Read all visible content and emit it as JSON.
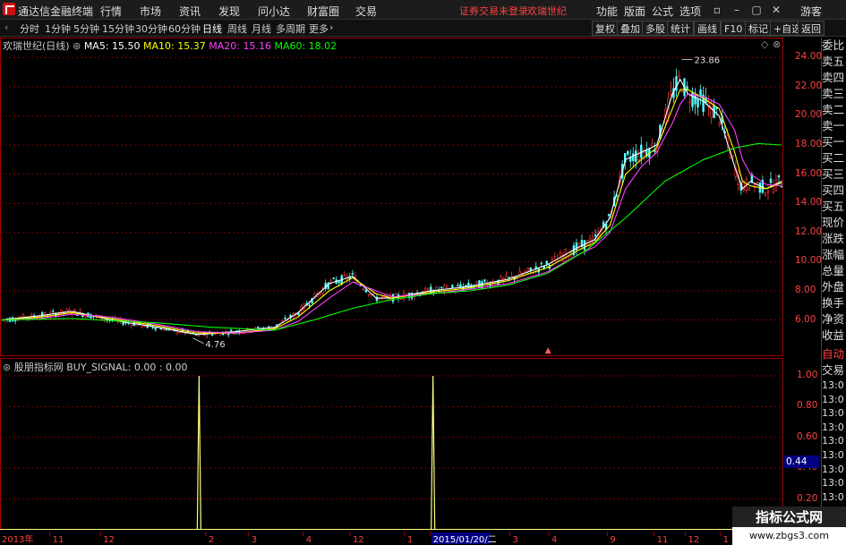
{
  "app": {
    "title": "通达信金融终端",
    "menu": [
      "行情",
      "市场",
      "资讯",
      "发现",
      "问小达",
      "财富圈",
      "交易"
    ],
    "warning": "证券交易未登录",
    "stock_name": "欢瑞世纪",
    "right_menu": [
      "功能",
      "版面",
      "公式",
      "选项"
    ],
    "guest": "游客"
  },
  "toolbar": {
    "periods": [
      "分时",
      "1分钟",
      "5分钟",
      "15分钟",
      "30分钟",
      "60分钟",
      "日线",
      "周线",
      "月线",
      "多周期",
      "更多"
    ],
    "active_period": "日线",
    "right_buttons": [
      "复权",
      "叠加",
      "多股",
      "统计",
      "画线",
      "F10",
      "标记",
      "+自选",
      "返回"
    ]
  },
  "main_legend": {
    "title": "欢瑞世纪(日线)",
    "ma5_label": "MA5: 15.50",
    "ma10_label": "MA10: 15.37",
    "ma20_label": "MA20: 15.16",
    "ma60_label": "MA60: 18.02",
    "colors": {
      "ma5": "#ffffff",
      "ma10": "#ffff00",
      "ma20": "#ff40ff",
      "ma60": "#00ff00"
    }
  },
  "sub_legend": {
    "title": "股朋指标网  BUY_SIGNAL: 0.00 : 0.00"
  },
  "chart_data": [
    {
      "type": "line",
      "title": "欢瑞世纪(日线)",
      "ylim": [
        4.5,
        25
      ],
      "yticks": [
        "24.00",
        "22.00",
        "20.00",
        "18.00",
        "16.00",
        "14.00",
        "12.00",
        "10.00",
        "8.00",
        "6.00"
      ],
      "annotations": [
        {
          "label": "23.86",
          "t": 0.872,
          "value": 23.86
        },
        {
          "label": "4.76",
          "t": 0.245,
          "value": 4.76
        }
      ],
      "series": [
        {
          "name": "MA5",
          "color": "#ffffff",
          "t": [
            0,
            0.05,
            0.09,
            0.14,
            0.2,
            0.25,
            0.3,
            0.35,
            0.38,
            0.42,
            0.45,
            0.48,
            0.5,
            0.55,
            0.6,
            0.65,
            0.7,
            0.74,
            0.76,
            0.78,
            0.8,
            0.82,
            0.84,
            0.86,
            0.87,
            0.88,
            0.9,
            0.92,
            0.94,
            0.95,
            0.96,
            0.98,
            1.0
          ],
          "values": [
            6.0,
            6.3,
            6.6,
            6.0,
            5.5,
            5.0,
            5.2,
            5.5,
            6.5,
            8.5,
            9.0,
            7.5,
            7.5,
            8.0,
            8.3,
            8.8,
            9.8,
            11.0,
            11.5,
            13.0,
            17.0,
            17.5,
            18.0,
            21.5,
            22.5,
            21.5,
            21.0,
            20.0,
            16.5,
            15.0,
            15.5,
            15.0,
            15.5
          ]
        },
        {
          "name": "MA10",
          "color": "#ffff00",
          "t": [
            0,
            0.05,
            0.09,
            0.14,
            0.2,
            0.25,
            0.3,
            0.35,
            0.38,
            0.42,
            0.45,
            0.48,
            0.5,
            0.55,
            0.6,
            0.65,
            0.7,
            0.74,
            0.76,
            0.78,
            0.8,
            0.82,
            0.84,
            0.86,
            0.87,
            0.88,
            0.9,
            0.92,
            0.94,
            0.95,
            0.96,
            0.98,
            1.0
          ],
          "values": [
            6.0,
            6.2,
            6.5,
            6.1,
            5.6,
            5.1,
            5.1,
            5.4,
            6.2,
            8.0,
            8.9,
            7.8,
            7.5,
            7.9,
            8.2,
            8.7,
            9.6,
            10.8,
            11.3,
            12.5,
            16.0,
            17.0,
            17.8,
            20.5,
            21.8,
            21.8,
            21.2,
            20.5,
            17.5,
            15.5,
            15.2,
            15.0,
            15.4
          ]
        },
        {
          "name": "MA20",
          "color": "#ff40ff",
          "t": [
            0,
            0.05,
            0.09,
            0.14,
            0.2,
            0.25,
            0.3,
            0.35,
            0.38,
            0.42,
            0.45,
            0.48,
            0.5,
            0.55,
            0.6,
            0.65,
            0.7,
            0.74,
            0.76,
            0.78,
            0.8,
            0.82,
            0.84,
            0.86,
            0.87,
            0.88,
            0.9,
            0.92,
            0.94,
            0.95,
            0.96,
            0.98,
            1.0
          ],
          "values": [
            6.0,
            6.1,
            6.4,
            6.2,
            5.7,
            5.2,
            5.1,
            5.3,
            5.9,
            7.5,
            8.6,
            8.0,
            7.6,
            7.8,
            8.1,
            8.5,
            9.3,
            10.5,
            11.0,
            12.0,
            15.0,
            16.5,
            17.5,
            19.5,
            20.8,
            21.5,
            21.3,
            20.8,
            19.0,
            17.0,
            16.0,
            15.3,
            15.2
          ]
        },
        {
          "name": "MA60",
          "color": "#00ff00",
          "t": [
            0,
            0.09,
            0.2,
            0.27,
            0.35,
            0.4,
            0.45,
            0.5,
            0.55,
            0.6,
            0.65,
            0.7,
            0.75,
            0.8,
            0.85,
            0.9,
            0.94,
            0.97,
            1.0
          ],
          "values": [
            6.0,
            6.1,
            5.8,
            5.5,
            5.3,
            6.0,
            6.8,
            7.4,
            7.8,
            8.0,
            8.4,
            9.2,
            10.8,
            13.0,
            15.5,
            17.0,
            17.8,
            18.1,
            18.0
          ]
        }
      ]
    },
    {
      "type": "line",
      "title": "BUY_SIGNAL",
      "ylim": [
        0,
        1
      ],
      "yticks": [
        "1.00",
        "0.80",
        "0.60",
        "0.40",
        "0.20"
      ],
      "current_label": "0.44",
      "series": [
        {
          "name": "BUY_SIGNAL",
          "color": "#ffff80",
          "signals_t": [
            0.253,
            0.553
          ]
        }
      ]
    }
  ],
  "xaxis": {
    "labels": [
      "2013年",
      "11",
      "12",
      "2",
      "3",
      "4",
      "12",
      "1",
      "2015/01/20/二",
      "3",
      "4",
      "9",
      "11",
      "12",
      "1"
    ],
    "label_t": [
      0.0,
      0.065,
      0.13,
      0.265,
      0.32,
      0.39,
      0.45,
      0.52,
      0.553,
      0.655,
      0.705,
      0.78,
      0.84,
      0.88,
      0.925
    ]
  },
  "right_panel": {
    "items": [
      "委比",
      "卖五",
      "卖四",
      "卖三",
      "卖二",
      "卖一",
      "买一",
      "买二",
      "买三",
      "买四",
      "买五",
      "现价",
      "涨跌",
      "涨幅",
      "总量",
      "外盘",
      "换手",
      "净资",
      "收益"
    ],
    "bottom_items": [
      "自动",
      "交易",
      "13:0",
      "13:0",
      "13:0",
      "13:0",
      "13:0",
      "13:0",
      "13:0",
      "13:0",
      "13:0",
      "13:0"
    ]
  },
  "watermark": {
    "title": "指标公式网",
    "url": "www.zbgs3.com"
  }
}
